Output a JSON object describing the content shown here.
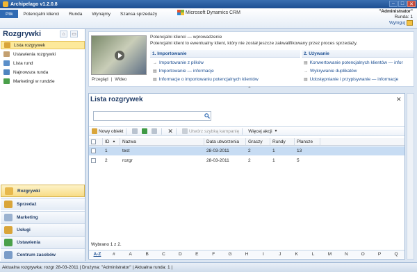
{
  "window": {
    "title": "Archipelago v1.2.0.8"
  },
  "menu": [
    {
      "label": "Plik"
    },
    {
      "label": "Potencjalni klienci"
    },
    {
      "label": "Runda"
    },
    {
      "label": "Wynajmy"
    },
    {
      "label": "Szansa sprzedaży"
    }
  ],
  "brand": {
    "text": "Microsoft Dynamics CRM"
  },
  "user": {
    "name": "\"Administrator\"",
    "round": "Runda: 1",
    "logout": "Wyloguj"
  },
  "nav": {
    "title": "Rozgrywki",
    "items": [
      {
        "label": "Lista rozgrywek",
        "color": "#d9a53a"
      },
      {
        "label": "Ustawienia rozgrywki",
        "color": "#c4a070"
      },
      {
        "label": "Lista rund",
        "color": "#5b8fc9"
      },
      {
        "label": "Najnowsza runda",
        "color": "#4f85c0"
      },
      {
        "label": "Marketingi w rundzie",
        "color": "#4aa04a"
      }
    ],
    "areas": [
      {
        "label": "Rozgrywki",
        "color": "#e7b84d"
      },
      {
        "label": "Sprzedaż",
        "color": "#d9a53a"
      },
      {
        "label": "Marketing",
        "color": "#9bb2d0"
      },
      {
        "label": "Usługi",
        "color": "#d9a53a"
      },
      {
        "label": "Ustawienia",
        "color": "#4aa04a"
      },
      {
        "label": "Centrum zasobów",
        "color": "#7a9cc8"
      }
    ]
  },
  "intro": {
    "title": "Potencjalni klienci — wprowadzenie",
    "text": "Potencjalni klient to ewentualny klient, który nie został jeszcze zakwalifikowany przez proces sprzedaży.",
    "thumb_links": [
      "Przegląd",
      "|",
      "Wideo"
    ],
    "sections": [
      {
        "title": "1. Importowanie",
        "links": [
          "Importowanie z plików",
          "Importowanie — informacje",
          "Informacje o importowaniu potencjalnych klientów"
        ]
      },
      {
        "title": "2. Używanie",
        "links": [
          "Konwertowanie potencjalnych klientów — infor",
          "Wykrywanie duplikatów",
          "Udostępnianie i przypisywanie — informacje"
        ]
      }
    ]
  },
  "grid": {
    "title": "Lista rozgrywek",
    "search_placeholder": "",
    "toolbar": {
      "new": "Nowy obiekt",
      "quick_campaign": "Utwórz szybką kampanię",
      "more": "Więcej akcji"
    },
    "columns": [
      "ID",
      "Nazwa",
      "Data utworzenia",
      "Graczy",
      "Rundy",
      "Plansze"
    ],
    "rows": [
      {
        "id": "1",
        "name": "test",
        "date": "28-03-2011",
        "players": "2",
        "rounds": "1",
        "boards": "13",
        "selected": true
      },
      {
        "id": "2",
        "name": "rozgr",
        "date": "28-03-2011",
        "players": "2",
        "rounds": "1",
        "boards": "5",
        "selected": false
      }
    ],
    "selection_info": "Wybrano 1 z 2.",
    "alpha": [
      "A-Z",
      "#",
      "A",
      "B",
      "C",
      "D",
      "E",
      "F",
      "G",
      "H",
      "I",
      "J",
      "K",
      "L",
      "M",
      "N",
      "O",
      "P",
      "Q"
    ]
  },
  "status": {
    "text": "Aktualna rozgrywka:  rozgr 28-03-2011  |  Drużyna:  \"Administrator\"  |  Aktualna runda:  1  |"
  }
}
